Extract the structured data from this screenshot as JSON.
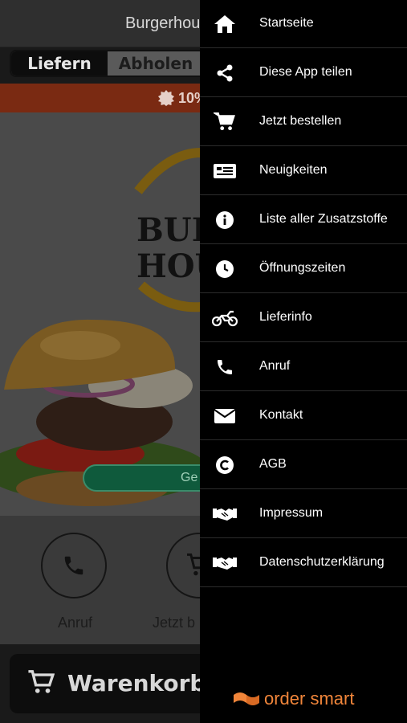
{
  "header": {
    "title": "Burgerhous"
  },
  "mode_toggle": {
    "deliver": "Liefern",
    "pickup": "Abholen"
  },
  "promo": {
    "text": "10%"
  },
  "hero": {
    "button_text": "Ge"
  },
  "quick_actions": [
    {
      "label": "Anruf",
      "icon": "phone-icon"
    },
    {
      "label": "Jetzt b",
      "icon": "cart-icon"
    }
  ],
  "cart": {
    "label": "Warenkorb"
  },
  "drawer": {
    "items": [
      {
        "label": "Startseite",
        "icon": "home-icon"
      },
      {
        "label": "Diese App teilen",
        "icon": "share-icon"
      },
      {
        "label": "Jetzt bestellen",
        "icon": "cart-icon"
      },
      {
        "label": "Neuigkeiten",
        "icon": "newspaper-icon"
      },
      {
        "label": "Liste aller Zusatzstoffe",
        "icon": "info-icon"
      },
      {
        "label": "Öffnungszeiten",
        "icon": "clock-icon"
      },
      {
        "label": "Lieferinfo",
        "icon": "motorcycle-icon"
      },
      {
        "label": "Anruf",
        "icon": "phone-icon"
      },
      {
        "label": "Kontakt",
        "icon": "envelope-icon"
      },
      {
        "label": "AGB",
        "icon": "copyright-icon"
      },
      {
        "label": "Impressum",
        "icon": "handshake-icon"
      },
      {
        "label": "Datenschutzerklärung",
        "icon": "handshake-icon"
      }
    ],
    "brand": "order smart"
  },
  "colors": {
    "brand_orange": "#f0853a",
    "promo_red": "#7a2a12",
    "drawer_bg": "#000000"
  }
}
